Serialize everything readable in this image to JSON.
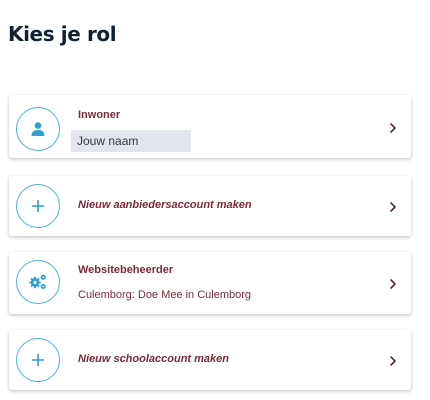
{
  "page": {
    "title": "Kies je rol"
  },
  "colors": {
    "accent": "#4fb0da",
    "label": "#7a2b3a",
    "heading": "#0e2233",
    "field_bg": "#e2e6ec"
  },
  "roles": [
    {
      "icon": "user-icon",
      "title": "Inwoner",
      "field_value": "Jouw naam"
    },
    {
      "icon": "plus-icon",
      "title": "Nieuw aanbiedersaccount maken"
    },
    {
      "icon": "gears-icon",
      "title": "Websitebeheerder",
      "subtitle": "Culemborg: Doe Mee in Culemborg"
    },
    {
      "icon": "plus-icon",
      "title": "Nieuw schoolaccount maken"
    }
  ]
}
